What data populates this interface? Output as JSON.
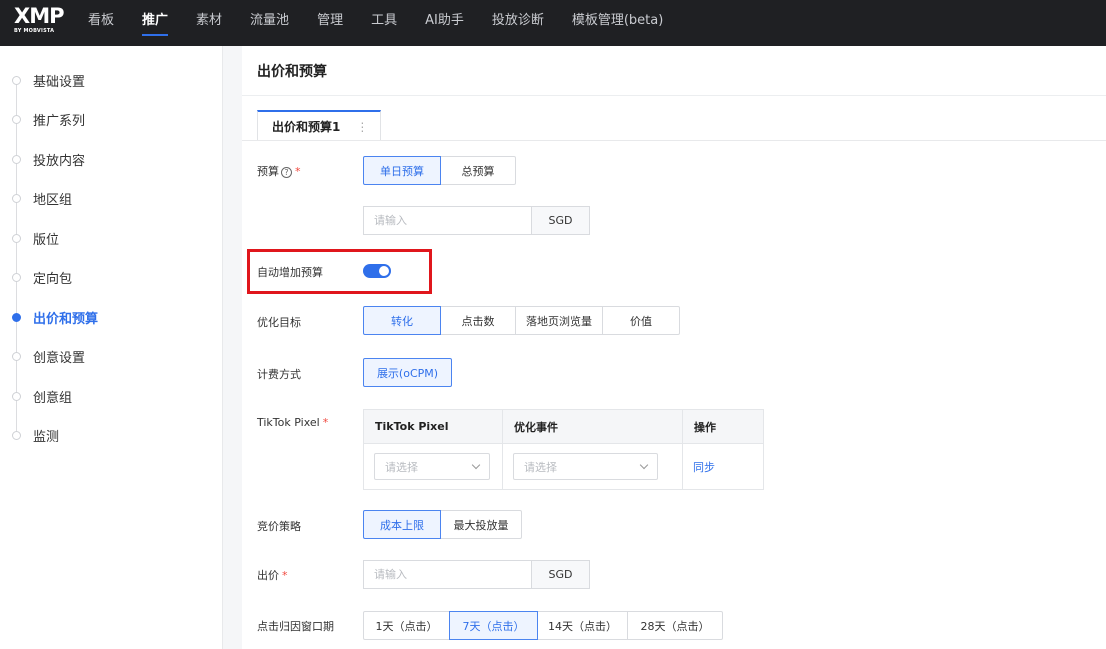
{
  "logo": {
    "mark": "XMP",
    "sub": "BY MOBVISTA"
  },
  "nav": [
    "看板",
    "推广",
    "素材",
    "流量池",
    "管理",
    "工具",
    "AI助手",
    "投放诊断",
    "模板管理(beta)"
  ],
  "steps": [
    "基础设置",
    "推广系列",
    "投放内容",
    "地区组",
    "版位",
    "定向包",
    "出价和预算",
    "创意设置",
    "创意组",
    "监测"
  ],
  "main": {
    "title": "出价和预算",
    "tab_label": "出价和预算1",
    "tab_more": "⋮"
  },
  "budget": {
    "label": "预算",
    "help": "?",
    "required": "*",
    "options": [
      "单日预算",
      "总预算"
    ],
    "placeholder": "请输入",
    "unit": "SGD"
  },
  "auto_budget": {
    "label": "自动增加预算",
    "enabled": true
  },
  "goal": {
    "label": "优化目标",
    "options": [
      "转化",
      "点击数",
      "落地页浏览量",
      "价值"
    ]
  },
  "billing": {
    "label": "计费方式",
    "options": [
      "展示(oCPM)"
    ]
  },
  "pixel": {
    "label": "TikTok Pixel",
    "required": "*",
    "headers": [
      "TikTok Pixel",
      "优化事件",
      "操作"
    ],
    "select1": "请选择",
    "select2": "请选择",
    "action": "同步"
  },
  "strategy": {
    "label": "竞价策略",
    "options": [
      "成本上限",
      "最大投放量"
    ]
  },
  "bid": {
    "label": "出价",
    "required": "*",
    "placeholder": "请输入",
    "unit": "SGD"
  },
  "window": {
    "label": "点击归因窗口期",
    "options": [
      "1天（点击）",
      "7天（点击）",
      "14天（点击）",
      "28天（点击）"
    ]
  },
  "colors": {
    "accent": "#2f6fea",
    "highlight": "#e0161c",
    "topbar": "#1f2023"
  }
}
